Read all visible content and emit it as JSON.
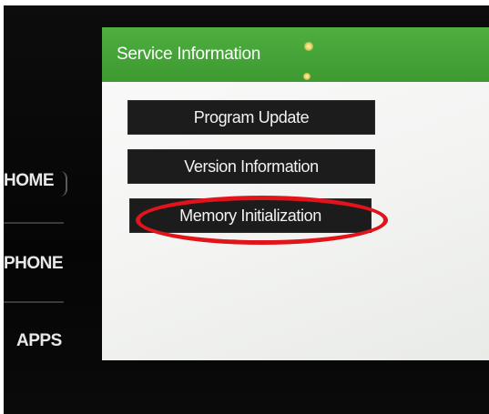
{
  "side_nav": {
    "home": "HOME",
    "phone": "PHONE",
    "apps": "APPS"
  },
  "screen": {
    "title": "Service Information",
    "menu": [
      {
        "label": "Program Update"
      },
      {
        "label": "Version Information"
      },
      {
        "label": "Memory Initialization"
      }
    ]
  },
  "colors": {
    "title_bar": "#44a438",
    "button_bg": "#1c1c1c",
    "highlight": "#e0141a"
  }
}
